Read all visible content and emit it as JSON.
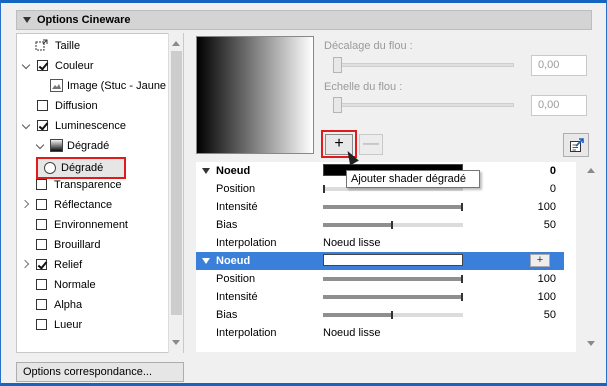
{
  "section": {
    "title": "Options Cineware"
  },
  "tree": {
    "items": [
      {
        "label": "Taille",
        "checkbox": null,
        "expander": null
      },
      {
        "label": "Couleur",
        "checkbox": true,
        "expander": "down"
      },
      {
        "label": "Image (Stuc - Jaune",
        "checkbox": null,
        "expander": null
      },
      {
        "label": "Diffusion",
        "checkbox": false,
        "expander": null
      },
      {
        "label": "Luminescence",
        "checkbox": true,
        "expander": "down"
      },
      {
        "label": "Dégradé",
        "checkbox": null,
        "expander": "down"
      },
      {
        "label": "Dégradé",
        "checkbox": null,
        "expander": null
      },
      {
        "label": "Transparence",
        "checkbox": false,
        "expander": null
      },
      {
        "label": "Réflectance",
        "checkbox": false,
        "expander": "right"
      },
      {
        "label": "Environnement",
        "checkbox": false,
        "expander": null
      },
      {
        "label": "Brouillard",
        "checkbox": false,
        "expander": null
      },
      {
        "label": "Relief",
        "checkbox": true,
        "expander": "right"
      },
      {
        "label": "Normale",
        "checkbox": false,
        "expander": null
      },
      {
        "label": "Alpha",
        "checkbox": false,
        "expander": null
      },
      {
        "label": "Lueur",
        "checkbox": false,
        "expander": null
      }
    ]
  },
  "options_button": {
    "label": "Options correspondance..."
  },
  "blur": {
    "offset_label": "Décalage du flou :",
    "offset_value": "0,00",
    "scale_label": "Echelle du flou :",
    "scale_value": "0,00"
  },
  "toolbar": {
    "plus": "+",
    "minus": "—"
  },
  "tooltip": {
    "text": "Ajouter shader dégradé"
  },
  "nodes": [
    {
      "title": "Noeud",
      "title_value": "0",
      "swatch": "#000000",
      "rows": [
        {
          "label": "Position",
          "value": "0",
          "level": 0.0
        },
        {
          "label": "Intensité",
          "value": "100",
          "level": 1.0
        },
        {
          "label": "Bias",
          "value": "50",
          "level": 0.5
        }
      ],
      "interp_label": "Interpolation",
      "interp_value": "Noeud lisse"
    },
    {
      "title": "Noeud",
      "swatch": "#ffffff",
      "add": "+",
      "rows": [
        {
          "label": "Position",
          "value": "100",
          "level": 1.0
        },
        {
          "label": "Intensité",
          "value": "100",
          "level": 1.0
        },
        {
          "label": "Bias",
          "value": "50",
          "level": 0.5
        }
      ],
      "interp_label": "Interpolation",
      "interp_value": "Noeud lisse"
    }
  ],
  "colors": {
    "highlight": "#e01b1b",
    "selection_blue": "#3a7fd9"
  }
}
